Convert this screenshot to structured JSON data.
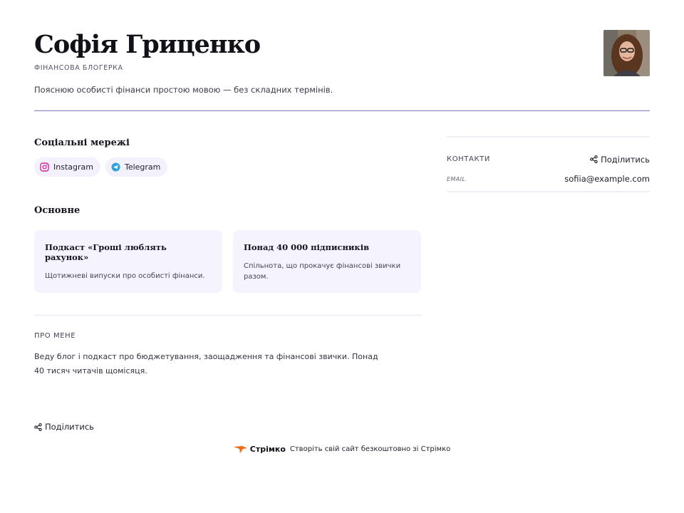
{
  "profile": {
    "name": "Софія Гриценко",
    "role": "ФІНАНСОВА БЛОГЕРКА",
    "tagline": "Пояснюю особисті фінанси простою мовою — без складних термінів."
  },
  "socials": {
    "title": "Соціальні мережі",
    "items": [
      {
        "label": "Instagram",
        "icon": "instagram-icon"
      },
      {
        "label": "Telegram",
        "icon": "telegram-icon"
      }
    ]
  },
  "basics": {
    "title": "Основне",
    "cards": [
      {
        "title": "Подкаст «Гроші люблять рахунок»",
        "text": "Щотижневі випуски про особисті фінанси."
      },
      {
        "title": "Понад 40 000 підписників",
        "text": "Спільнота, що прокачує фінансові звички разом."
      }
    ]
  },
  "about": {
    "label": "ПРО МЕНЕ",
    "text": "Веду блог і подкаст про бюджетування, заощадження та фінансові звички. Понад 40 тисяч читачів щомісяця."
  },
  "contacts": {
    "label": "КОНТАКТИ",
    "share_label": "Поділитись",
    "email_label": "EMAIL",
    "email_value": "sofiia@example.com"
  },
  "share_bottom": {
    "label": "Поділитись"
  },
  "footer": {
    "brand": "Стрімко",
    "text": "Створіть свій сайт безкоштовно зі Стрімко"
  },
  "colors": {
    "accent_line": "#7c80b8",
    "card_bg": "#f5f3fd",
    "instagram": "#d6249f",
    "telegram": "#2aa3dc",
    "brand_orange": "#f06a1c"
  }
}
